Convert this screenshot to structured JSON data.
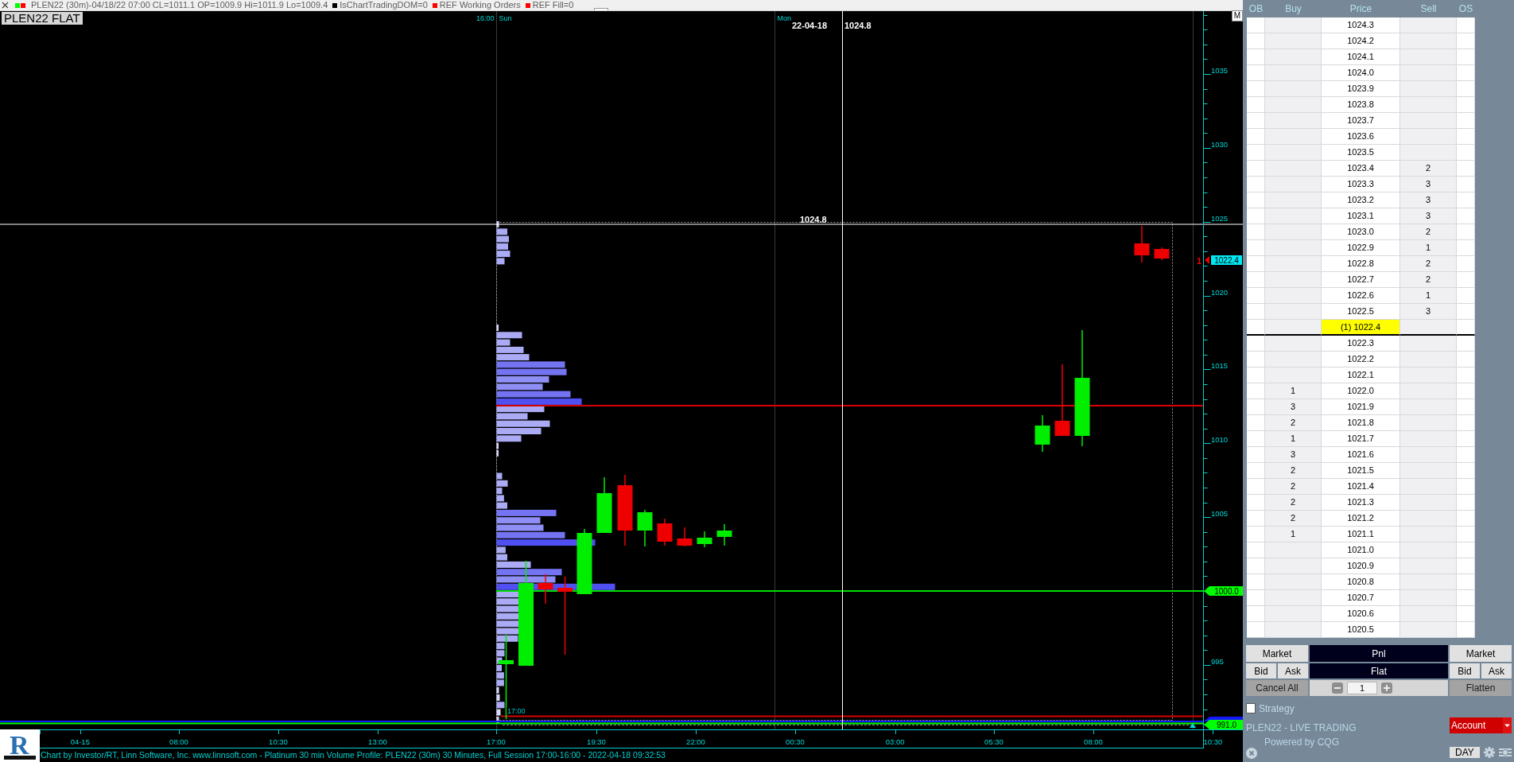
{
  "info_bar": {
    "items": [
      {
        "text": "PLEN22 (30m)-04/18/22 07:00 CL=1011.1 OP=1009.9 Hi=1011.9 Lo=1009.4",
        "swatches": [
          {
            "color": "#00ff00"
          },
          {
            "color": "#ff0000"
          }
        ]
      },
      {
        "text": "IsChartTradingDOM=0",
        "swatches": [
          {
            "color": "#000000"
          }
        ]
      },
      {
        "text": "REF Working Orders",
        "swatches": [
          {
            "color": "#ff0000"
          }
        ]
      },
      {
        "text": "REF Fill=0",
        "swatches": [
          {
            "color": "#ff0000"
          }
        ]
      }
    ]
  },
  "chart": {
    "symbol_label": "PLEN22 FLAT",
    "mode_button": "M",
    "session_labels": [
      {
        "time": "16:00",
        "day": "Sun"
      },
      {
        "day": "Mon"
      }
    ],
    "crosshair": {
      "date": "22-04-18",
      "price": "1024.8",
      "line_label": "1024.8"
    },
    "bar_label": "17:00",
    "price_axis": {
      "labels": [
        "1035",
        "1030",
        "1025",
        "1020",
        "1015",
        "1010",
        "1005",
        "995"
      ]
    },
    "price_tags": [
      {
        "kind": "position",
        "quantity": "1",
        "text": "1022.4",
        "color": "#00e8f0"
      },
      {
        "kind": "line",
        "text": "1000.0",
        "color": "#00ff00"
      },
      {
        "kind": "line",
        "text": "991.0",
        "color": "#00ff00"
      }
    ],
    "time_axis": {
      "labels": [
        "04-15",
        "08:00",
        "10:30",
        "13:00",
        "17:00",
        "19:30",
        "22:00",
        "00:30",
        "03:00",
        "05:30",
        "08:00",
        "10:30"
      ]
    }
  },
  "logo": {
    "letter": "R"
  },
  "status_line": "Chart by Investor/RT, Linn Software, Inc. www.linnsoft.com - Platinum 30 min Volume Profile: PLEN22 (30m) 30 Minutes, Full Session 17:00-16:00 - 2022-04-18 09:32:53",
  "dom": {
    "columns": [
      "OB",
      "Buy",
      "Price",
      "Sell",
      "OS"
    ],
    "rows": [
      {
        "price": "1024.3",
        "current": false
      },
      {
        "price": "1024.2",
        "current": false
      },
      {
        "price": "1024.1",
        "current": false
      },
      {
        "price": "1024.0",
        "current": false
      },
      {
        "price": "1023.9",
        "current": false
      },
      {
        "price": "1023.8",
        "current": false
      },
      {
        "price": "1023.7",
        "current": false
      },
      {
        "price": "1023.6",
        "current": false
      },
      {
        "price": "1023.5",
        "current": false
      },
      {
        "price": "1023.4",
        "sell": "2",
        "current": false
      },
      {
        "price": "1023.3",
        "sell": "3",
        "current": false
      },
      {
        "price": "1023.2",
        "sell": "3",
        "current": false
      },
      {
        "price": "1023.1",
        "sell": "3",
        "current": false
      },
      {
        "price": "1023.0",
        "sell": "2",
        "current": false
      },
      {
        "price": "1022.9",
        "sell": "1",
        "current": false
      },
      {
        "price": "1022.8",
        "sell": "2",
        "current": false
      },
      {
        "price": "1022.7",
        "sell": "2",
        "current": false
      },
      {
        "price": "1022.6",
        "sell": "1",
        "current": false
      },
      {
        "price": "1022.5",
        "sell": "3",
        "current": false
      },
      {
        "price": "(1) 1022.4",
        "current": true
      },
      {
        "price": "1022.3",
        "current": false
      },
      {
        "price": "1022.2",
        "current": false
      },
      {
        "price": "1022.1",
        "current": false
      },
      {
        "price": "1022.0",
        "buy": "1",
        "current": false
      },
      {
        "price": "1021.9",
        "buy": "3",
        "current": false
      },
      {
        "price": "1021.8",
        "buy": "2",
        "current": false
      },
      {
        "price": "1021.7",
        "buy": "1",
        "current": false
      },
      {
        "price": "1021.6",
        "buy": "3",
        "current": false
      },
      {
        "price": "1021.5",
        "buy": "2",
        "current": false
      },
      {
        "price": "1021.4",
        "buy": "2",
        "current": false
      },
      {
        "price": "1021.3",
        "buy": "2",
        "current": false
      },
      {
        "price": "1021.2",
        "buy": "2",
        "current": false
      },
      {
        "price": "1021.1",
        "buy": "1",
        "current": false
      },
      {
        "price": "1021.0",
        "current": false
      },
      {
        "price": "1020.9",
        "current": false
      },
      {
        "price": "1020.8",
        "current": false
      },
      {
        "price": "1020.7",
        "current": false
      },
      {
        "price": "1020.6",
        "current": false
      },
      {
        "price": "1020.5",
        "current": false
      }
    ],
    "left_buttons": [
      {
        "label": "Market"
      },
      {
        "label": "Bid"
      },
      {
        "label": "Ask"
      }
    ],
    "pnl": {
      "label": "Pnl",
      "value": "Flat"
    },
    "right_buttons": [
      {
        "label": "Market"
      },
      {
        "label": "Bid"
      },
      {
        "label": "Ask"
      }
    ],
    "cancel_all": "Cancel All",
    "quantity": "1",
    "flatten": "Flatten",
    "strategy": {
      "label": "Strategy",
      "checked": false
    },
    "account_name": "PLEN22 - LIVE TRADING",
    "powered_by": "Powered by CQG",
    "account_dropdown": "Account",
    "day_button": "DAY"
  }
}
